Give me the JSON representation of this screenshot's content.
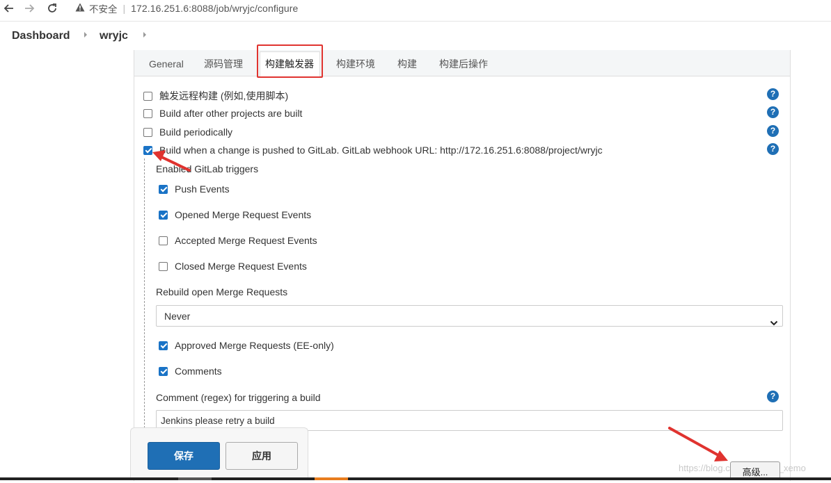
{
  "browser": {
    "insecure_label": "不安全",
    "url": "172.16.251.6:8088/job/wryjc/configure"
  },
  "breadcrumb": {
    "items": [
      "Dashboard",
      "wryjc"
    ]
  },
  "tabs": [
    {
      "label": "General"
    },
    {
      "label": "源码管理"
    },
    {
      "label": "构建触发器",
      "active": true
    },
    {
      "label": "构建环境"
    },
    {
      "label": "构建"
    },
    {
      "label": "构建后操作"
    }
  ],
  "triggers": [
    {
      "label": "触发远程构建 (例如,使用脚本)",
      "checked": false
    },
    {
      "label": "Build after other projects are built",
      "checked": false
    },
    {
      "label": "Build periodically",
      "checked": false
    },
    {
      "label": "Build when a change is pushed to GitLab. GitLab webhook URL: http://172.16.251.6:8088/project/wryjc",
      "checked": true
    }
  ],
  "gitlab": {
    "enabled_triggers_label": "Enabled GitLab triggers",
    "events": [
      {
        "label": "Push Events",
        "checked": true
      },
      {
        "label": "Opened Merge Request Events",
        "checked": true
      },
      {
        "label": "Accepted Merge Request Events",
        "checked": false
      },
      {
        "label": "Closed Merge Request Events",
        "checked": false
      }
    ],
    "rebuild_label": "Rebuild open Merge Requests",
    "rebuild_value": "Never",
    "extra": [
      {
        "label": "Approved Merge Requests (EE-only)",
        "checked": true
      },
      {
        "label": "Comments",
        "checked": true
      }
    ],
    "comment_regex_label": "Comment (regex) for triggering a build",
    "comment_regex_value": "Jenkins please retry a build"
  },
  "buttons": {
    "save": "保存",
    "apply": "应用",
    "advanced": "高级..."
  },
  "watermark": "https://blog.csdn.net/wee_xemo",
  "help_glyph": "?",
  "colors": {
    "accent": "#1f6fb5",
    "highlight_box": "#e0332f",
    "arrow": "#e0332f"
  }
}
